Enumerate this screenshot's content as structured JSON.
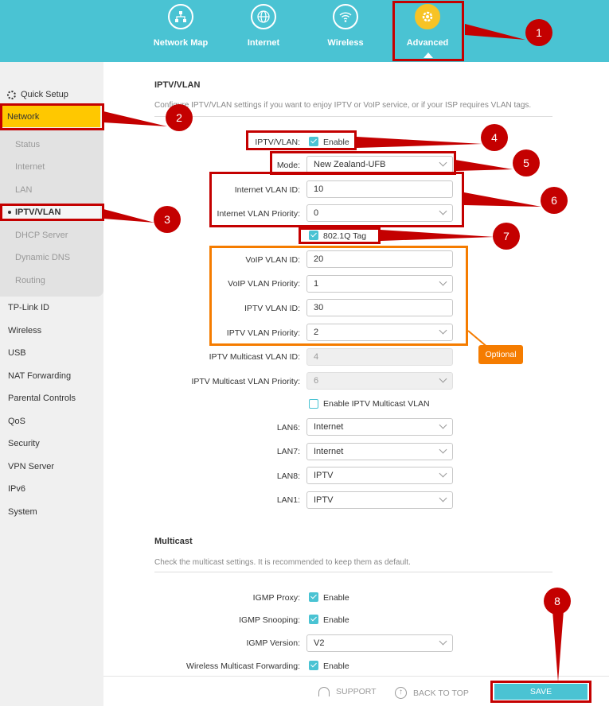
{
  "nav": {
    "items": [
      {
        "label": "Network Map",
        "icon": "network-map-icon"
      },
      {
        "label": "Internet",
        "icon": "globe-icon"
      },
      {
        "label": "Wireless",
        "icon": "wifi-icon"
      },
      {
        "label": "Advanced",
        "icon": "gear-icon",
        "active": true
      }
    ]
  },
  "sidebar": {
    "quick_setup": "Quick Setup",
    "network": "Network",
    "sub": [
      "Status",
      "Internet",
      "LAN",
      "IPTV/VLAN",
      "DHCP Server",
      "Dynamic DNS",
      "Routing"
    ],
    "items": [
      "TP-Link ID",
      "Wireless",
      "USB",
      "NAT Forwarding",
      "Parental Controls",
      "QoS",
      "Security",
      "VPN Server",
      "IPv6",
      "System"
    ]
  },
  "iptv": {
    "title": "IPTV/VLAN",
    "desc": "Configure IPTV/VLAN settings if you want to enjoy IPTV or VoIP service, or if your ISP requires VLAN tags.",
    "enable_label": "IPTV/VLAN:",
    "enable_text": "Enable",
    "mode_label": "Mode:",
    "mode_value": "New Zealand-UFB",
    "internet_vlan_id_label": "Internet VLAN ID:",
    "internet_vlan_id": "10",
    "internet_vlan_priority_label": "Internet VLAN Priority:",
    "internet_vlan_priority": "0",
    "tag_label": "802.1Q Tag",
    "voip_vlan_id_label": "VoIP VLAN ID:",
    "voip_vlan_id": "20",
    "voip_vlan_priority_label": "VoIP VLAN Priority:",
    "voip_vlan_priority": "1",
    "iptv_vlan_id_label": "IPTV VLAN ID:",
    "iptv_vlan_id": "30",
    "iptv_vlan_priority_label": "IPTV VLAN Priority:",
    "iptv_vlan_priority": "2",
    "multicast_vlan_id_label": "IPTV Multicast VLAN ID:",
    "multicast_vlan_id": "4",
    "multicast_vlan_priority_label": "IPTV Multicast VLAN Priority:",
    "multicast_vlan_priority": "6",
    "enable_multicast_vlan": "Enable IPTV Multicast VLAN",
    "lan6_label": "LAN6:",
    "lan6": "Internet",
    "lan7_label": "LAN7:",
    "lan7": "Internet",
    "lan8_label": "LAN8:",
    "lan8": "IPTV",
    "lan1_label": "LAN1:",
    "lan1": "IPTV"
  },
  "multicast": {
    "title": "Multicast",
    "desc": "Check the multicast settings. It is recommended to keep them as default.",
    "igmp_proxy_label": "IGMP Proxy:",
    "igmp_snooping_label": "IGMP Snooping:",
    "igmp_version_label": "IGMP Version:",
    "igmp_version": "V2",
    "wireless_forwarding_label": "Wireless Multicast Forwarding:",
    "enable": "Enable"
  },
  "annotations": {
    "n1": "1",
    "n2": "2",
    "n3": "3",
    "n4": "4",
    "n5": "5",
    "n6": "6",
    "n7": "7",
    "n8": "8",
    "optional": "Optional"
  },
  "footer": {
    "support": "SUPPORT",
    "back_to_top": "BACK TO TOP",
    "save": "SAVE"
  },
  "colors": {
    "accent": "#4ac3d3",
    "highlight": "#ffc800",
    "annotation": "#c40000",
    "optional": "#f57c00"
  }
}
